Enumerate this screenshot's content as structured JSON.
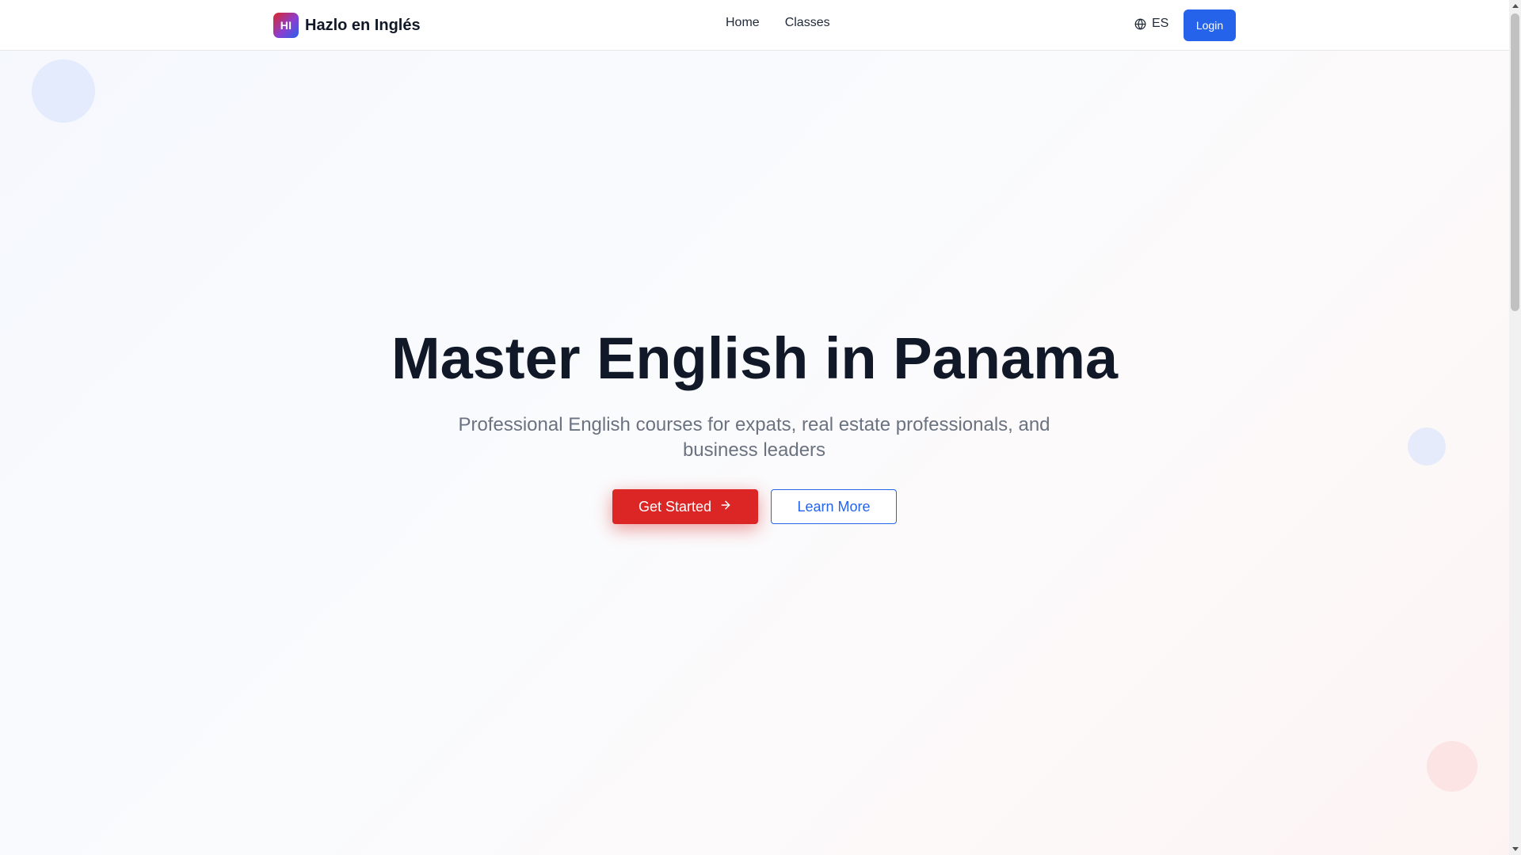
{
  "header": {
    "logo_text": "HI",
    "brand_name": "Hazlo en Inglés",
    "nav": [
      {
        "label": "Home"
      },
      {
        "label": "Classes"
      }
    ],
    "language": {
      "label": "ES",
      "icon": "globe-icon"
    },
    "login_label": "Login"
  },
  "hero": {
    "title": "Master English in Panama",
    "subtitle": "Professional English courses for expats, real estate professionals, and business leaders",
    "primary_cta": {
      "label": "Get Started",
      "icon": "arrow-right-icon"
    },
    "secondary_cta": {
      "label": "Learn More"
    }
  },
  "colors": {
    "primary_red": "#dc2626",
    "primary_blue": "#2563eb",
    "text_dark": "#111827",
    "text_muted": "#6b7280"
  }
}
